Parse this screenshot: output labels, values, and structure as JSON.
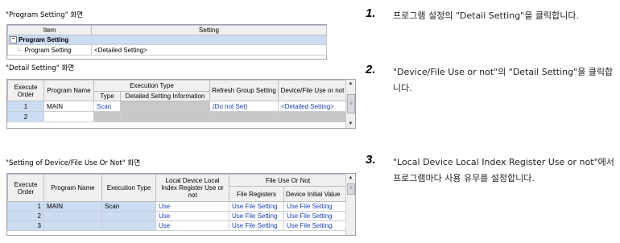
{
  "captions": {
    "program_setting": "\"Program Setting\" 화면",
    "detail_setting": "\"Detail Setting\" 화면",
    "device_file": "\"Setting of Device/File Use Or Not\" 화면"
  },
  "program_grid": {
    "headers": [
      "Item",
      "Setting"
    ],
    "group_label": "Program Setting",
    "group_toggle": "−",
    "row": {
      "item": "Program Setting",
      "setting": "<Detailed Setting>"
    }
  },
  "detail_grid": {
    "headers": {
      "exec_order": "Execute Order",
      "program_name": "Program Name",
      "execution_type": "Execution Type",
      "type": "Type",
      "detailed_info": "Detailed Setting Information",
      "refresh_group": "Refresh Group Setting",
      "device_file": "Device/File Use or not"
    },
    "rows": [
      {
        "order": "1",
        "name": "MAIN",
        "type": "Scan",
        "info": "",
        "refresh": "(Do not Set)",
        "device": "<Detailed Setting>"
      },
      {
        "order": "2",
        "name": "",
        "type": "",
        "info": "",
        "refresh": "",
        "device": ""
      }
    ]
  },
  "device_grid": {
    "headers": {
      "exec_order": "Execute Order",
      "program_name": "Program Name",
      "execution_type": "Execution Type",
      "local_device": "Local Device Local Index Register Use or not",
      "file_use": "File Use Or Not",
      "file_registers": "File Registers",
      "device_initial": "Device Initial Value"
    },
    "rows": [
      {
        "order": "1",
        "name": "MAIN",
        "type": "Scan",
        "local": "Use",
        "file_reg": "Use File Setting",
        "dev_init": "Use File Setting"
      },
      {
        "order": "2",
        "name": "",
        "type": "",
        "local": "Use",
        "file_reg": "Use File Setting",
        "dev_init": "Use File Setting"
      },
      {
        "order": "3",
        "name": "",
        "type": "",
        "local": "Use",
        "file_reg": "Use File Setting",
        "dev_init": "Use File Setting"
      }
    ]
  },
  "steps": [
    {
      "num": "1.",
      "text": "프로그램 설정의 \"Detail Setting\"을 클릭합니다."
    },
    {
      "num": "2.",
      "text": "\"Device/File Use or not\"의 \"Detail Setting\"을 클릭합니다."
    },
    {
      "num": "3.",
      "text": "\"Local Device Local Index Register Use or not\"에서 프로그램마다 사용 유무를 설정합니다."
    }
  ],
  "scroll_glyphs": {
    "up": "▲",
    "down": "▼",
    "grip": "≡"
  }
}
